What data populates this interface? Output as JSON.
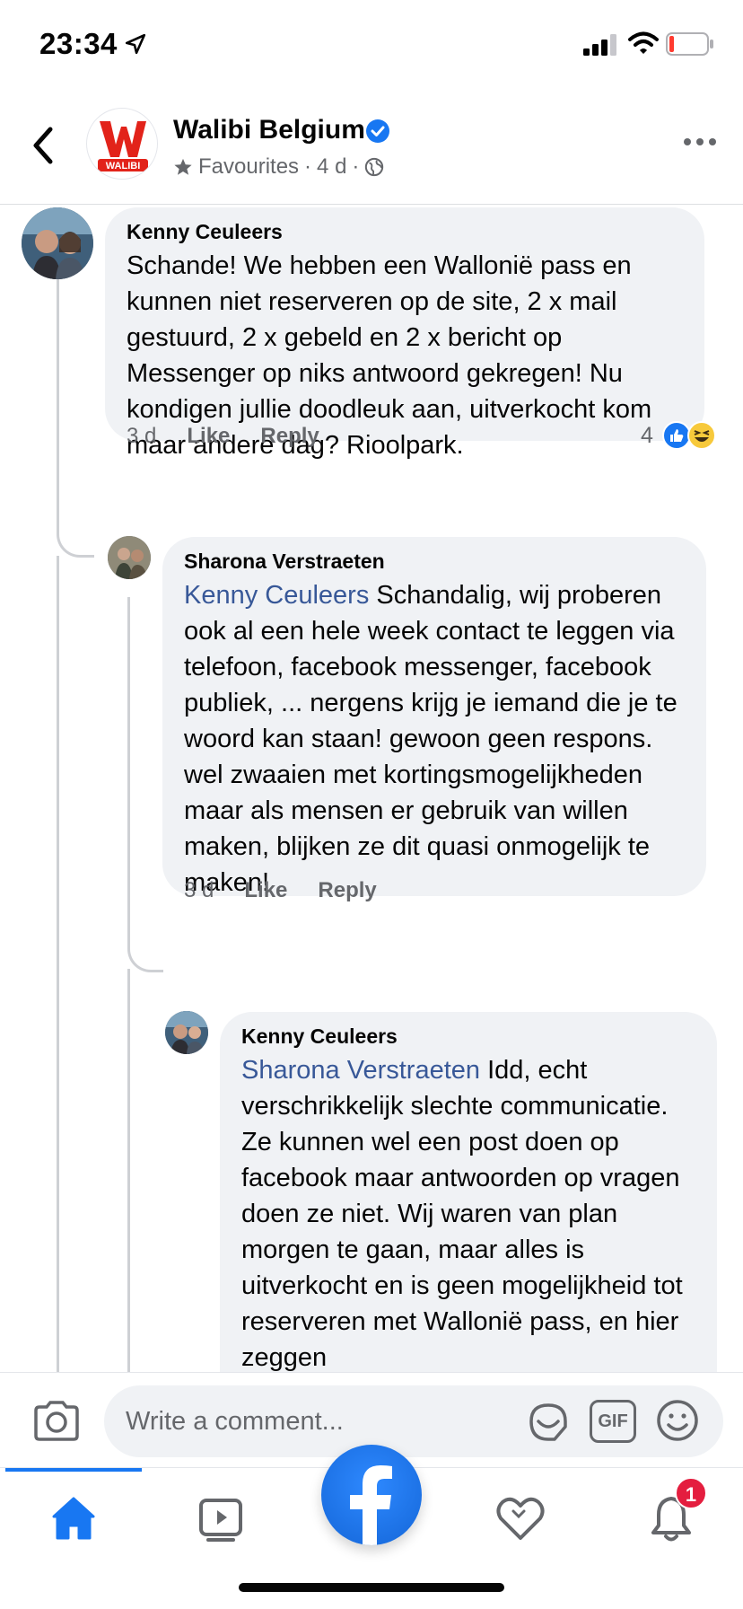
{
  "status_bar": {
    "time": "23:34"
  },
  "header": {
    "page_name": "Walibi Belgium",
    "favourites_label": "Favourites",
    "separator": "·",
    "age": "4 d",
    "logo_text": "WALIBI"
  },
  "comments": [
    {
      "author": "Kenny Ceuleers",
      "mention": "",
      "text": "Schande! We hebben een Wallonië pass en kunnen niet reserveren op de site, 2 x mail gestuurd, 2 x gebeld en 2 x bericht op Messenger op niks antwoord gekregen! Nu kondigen jullie doodleuk aan, uitverkocht kom maar andere dag? Rioolpark.",
      "time": "3 d",
      "like_label": "Like",
      "reply_label": "Reply",
      "reaction_count": "4"
    },
    {
      "author": "Sharona Verstraeten",
      "mention": "Kenny Ceuleers",
      "text": " Schandalig, wij proberen ook al een hele week contact te leggen via telefoon, facebook messenger, facebook publiek, ... nergens krijg je iemand die je te woord kan staan! gewoon geen respons. wel zwaaien met kortingsmogelijkheden maar als mensen er gebruik van willen maken, blijken ze dit quasi onmogelijk te maken!",
      "time": "3 d",
      "like_label": "Like",
      "reply_label": "Reply"
    },
    {
      "author": "Kenny Ceuleers",
      "mention": "Sharona Verstraeten",
      "text": " Idd, echt verschrikkelijk slechte communicatie. Ze kunnen wel een post doen op facebook maar antwoorden op vragen doen ze niet. Wij waren van plan morgen te gaan, maar alles is uitverkocht en is geen mogelijkheid tot reserveren met Wallonië pass, en hier zeggen"
    }
  ],
  "composer": {
    "placeholder": "Write a comment...",
    "gif_label": "GIF"
  },
  "tabbar": {
    "notification_count": "1"
  },
  "colors": {
    "accent": "#1877f2",
    "mention": "#385898",
    "bubble": "#f0f2f5",
    "badge": "#e41e3f",
    "walibi_red": "#e2231a"
  },
  "icons": [
    "location-arrow-icon",
    "signal-icon",
    "wifi-icon",
    "battery-icon",
    "back-icon",
    "verified-icon",
    "star-icon",
    "globe-icon",
    "more-icon",
    "like-reaction-icon",
    "haha-reaction-icon",
    "camera-icon",
    "sticker-icon",
    "gif-icon",
    "emoji-icon",
    "home-icon",
    "watch-icon",
    "facebook-logo-icon",
    "heart-icon",
    "bell-icon"
  ]
}
